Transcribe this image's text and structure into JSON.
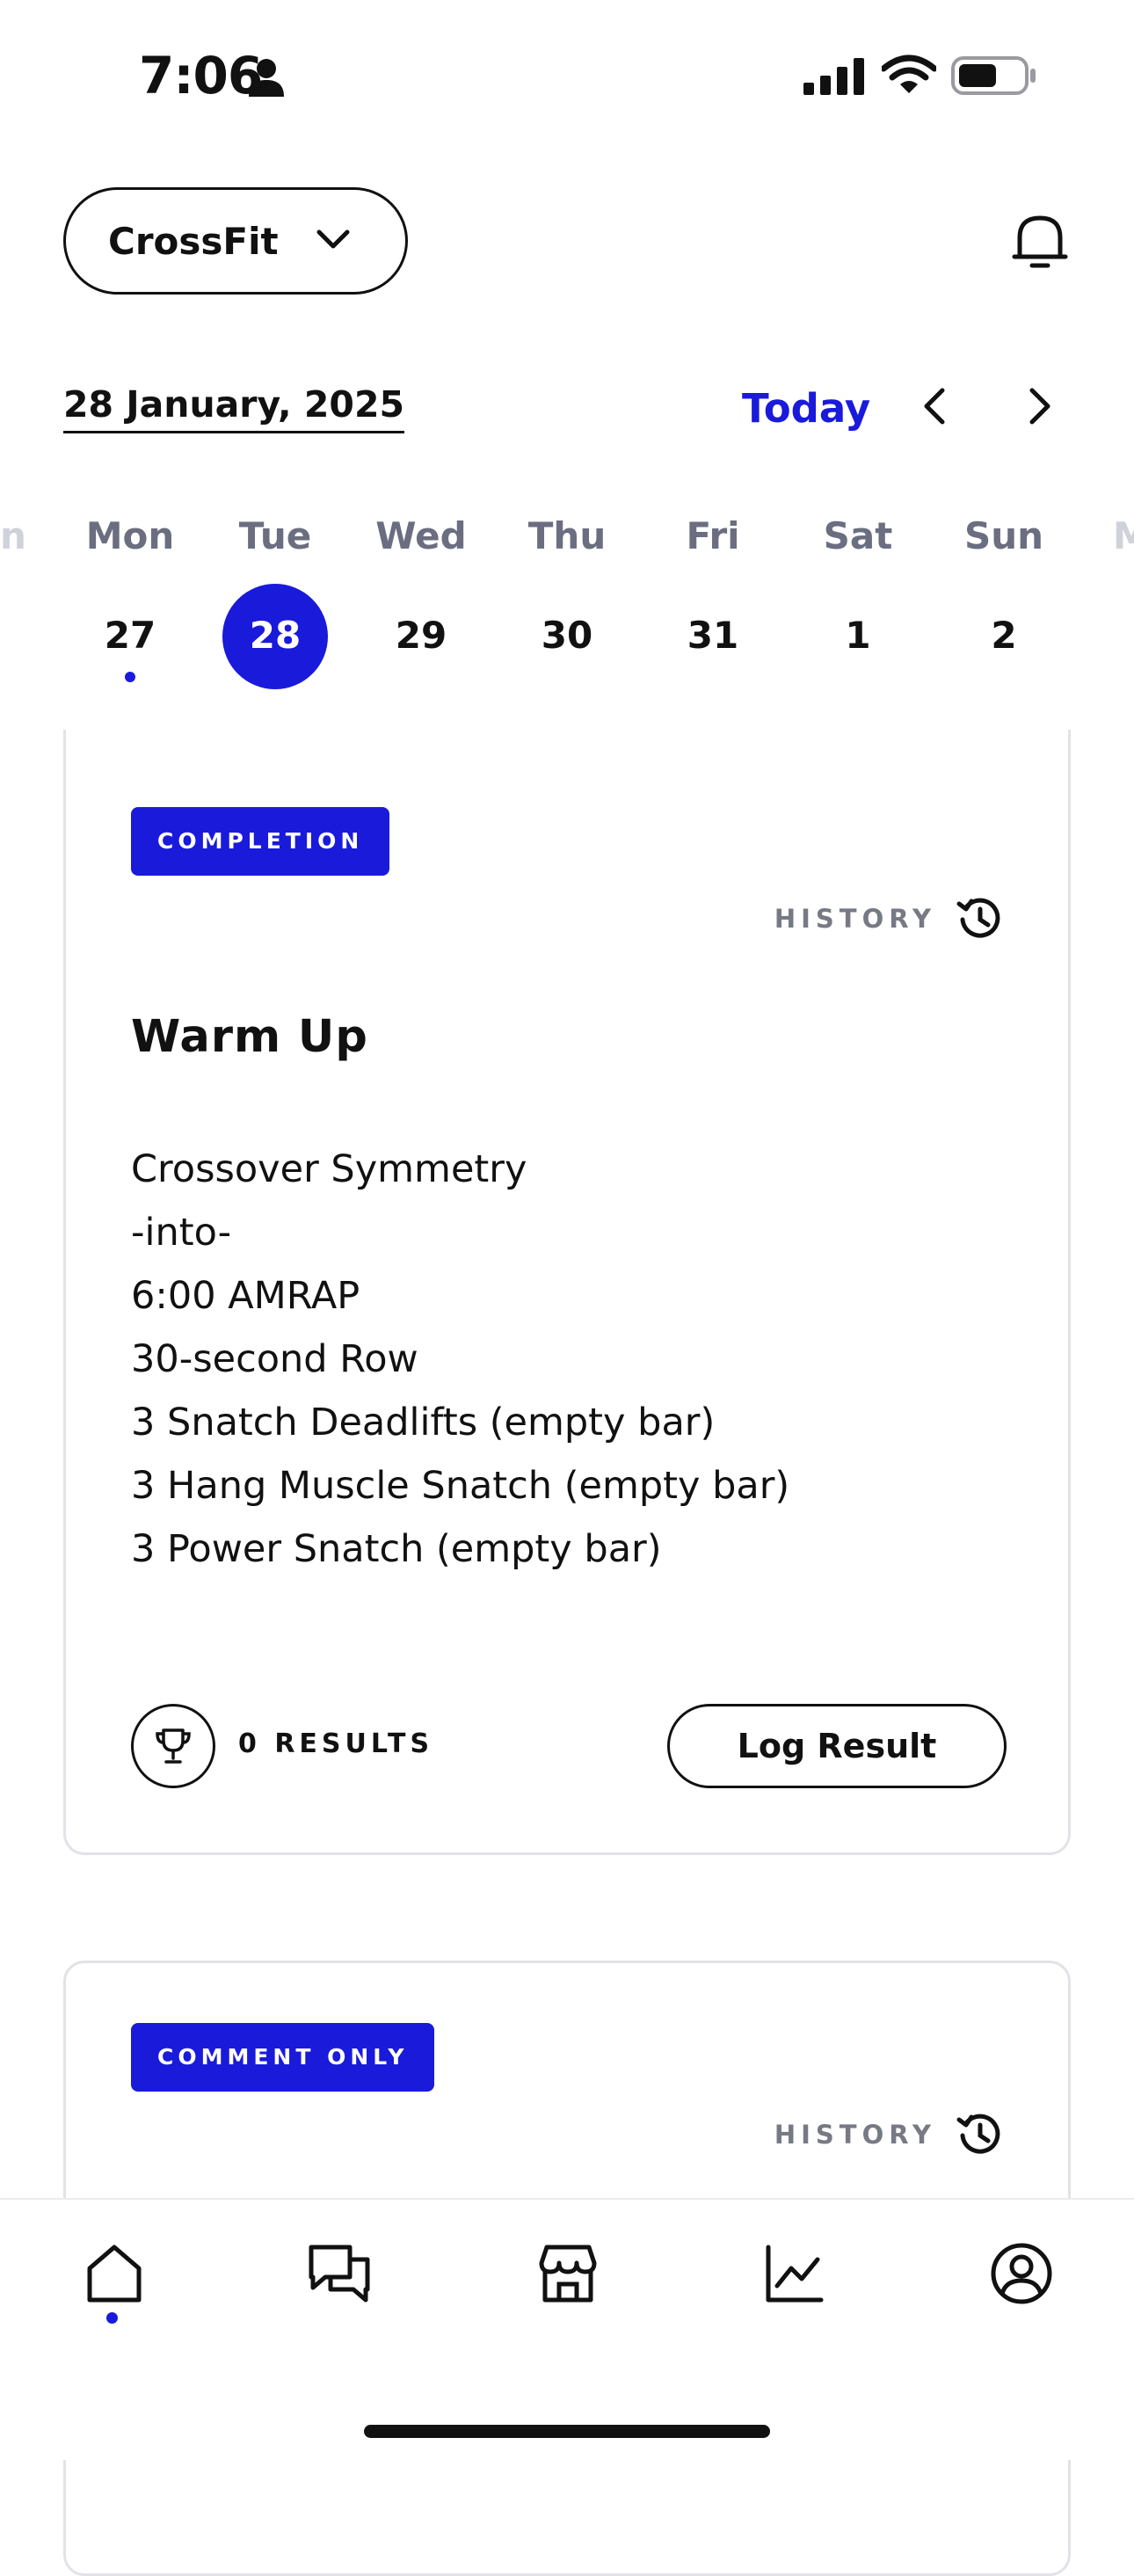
{
  "status_bar": {
    "time": "7:06",
    "battery_level": 0.6
  },
  "header": {
    "gym_name": "CrossFit",
    "notifications_icon": "bell-icon"
  },
  "date_nav": {
    "date_label": "28 January, 2025",
    "today_label": "Today"
  },
  "week": {
    "edge_left": "n",
    "edge_right": "M",
    "days": [
      {
        "name": "Mon",
        "num": "27",
        "selected": false,
        "has_dot": true
      },
      {
        "name": "Tue",
        "num": "28",
        "selected": true,
        "has_dot": false
      },
      {
        "name": "Wed",
        "num": "29",
        "selected": false,
        "has_dot": false
      },
      {
        "name": "Thu",
        "num": "30",
        "selected": false,
        "has_dot": false
      },
      {
        "name": "Fri",
        "num": "31",
        "selected": false,
        "has_dot": false
      },
      {
        "name": "Sat",
        "num": "1",
        "selected": false,
        "has_dot": false
      },
      {
        "name": "Sun",
        "num": "2",
        "selected": false,
        "has_dot": false
      }
    ]
  },
  "workouts": [
    {
      "badge": "COMPLETION",
      "history_label": "HISTORY",
      "title": "Warm Up",
      "lines": [
        "Crossover Symmetry",
        "-into-",
        "6:00 AMRAP",
        "30-second Row",
        "3 Snatch Deadlifts (empty bar)",
        "3 Hang Muscle Snatch (empty bar)",
        "3 Power Snatch (empty bar)"
      ],
      "results_label": "0 RESULTS",
      "log_button": "Log Result"
    },
    {
      "badge": "COMMENT ONLY",
      "history_label": "HISTORY"
    }
  ],
  "tabbar": {
    "active": "home",
    "tabs": [
      {
        "id": "home",
        "icon": "home-icon"
      },
      {
        "id": "messages",
        "icon": "chat-icon"
      },
      {
        "id": "store",
        "icon": "store-icon"
      },
      {
        "id": "progress",
        "icon": "chart-icon"
      },
      {
        "id": "profile",
        "icon": "profile-icon"
      }
    ]
  },
  "colors": {
    "accent": "#1a1adb",
    "muted": "#6b6e80",
    "border": "#e2e3e8"
  }
}
